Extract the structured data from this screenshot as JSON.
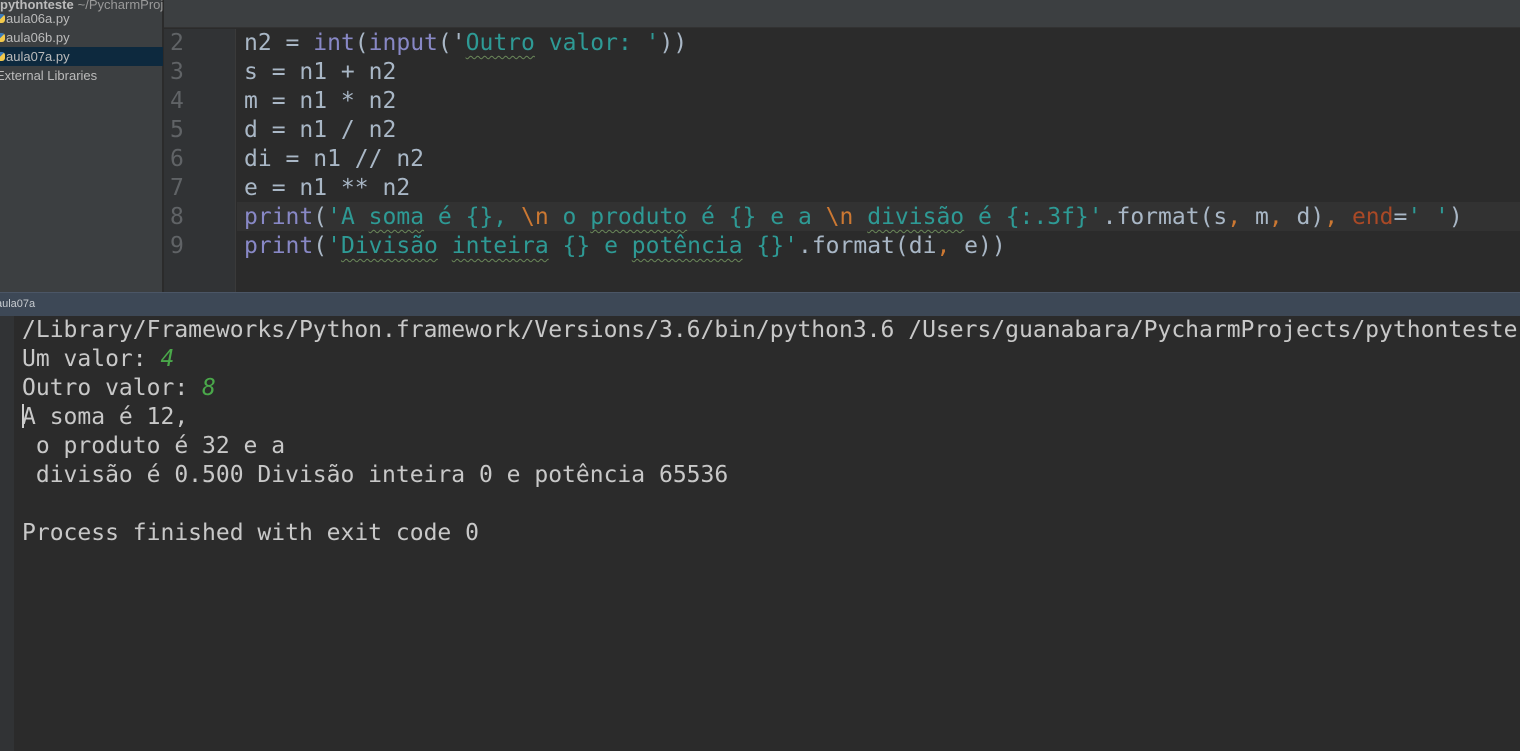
{
  "sidebar": {
    "project": "pythonteste",
    "project_path": "~/PycharmProj",
    "files": [
      "aula06a.py",
      "aula06b.py",
      "aula07a.py"
    ],
    "external": "External Libraries"
  },
  "editor": {
    "lines": [
      {
        "n": "2",
        "tokens": [
          [
            "n2 = ",
            ""
          ],
          [
            "int",
            "kw"
          ],
          [
            "(",
            ""
          ],
          [
            "input",
            "kw"
          ],
          [
            "(",
            ""
          ],
          [
            "'",
            ""
          ],
          [
            "Outro",
            "st wv"
          ],
          [
            " valor: '",
            "st"
          ],
          [
            "))",
            ""
          ]
        ]
      },
      {
        "n": "3",
        "tokens": [
          [
            "s = n1 + n2",
            ""
          ]
        ]
      },
      {
        "n": "4",
        "tokens": [
          [
            "m = n1 * n2",
            ""
          ]
        ]
      },
      {
        "n": "5",
        "tokens": [
          [
            "d = n1 / n2",
            ""
          ]
        ]
      },
      {
        "n": "6",
        "tokens": [
          [
            "di = n1 // n2",
            ""
          ]
        ]
      },
      {
        "n": "7",
        "tokens": [
          [
            "e = n1 ** n2",
            ""
          ]
        ]
      },
      {
        "n": "8",
        "tokens": [
          [
            "print",
            "kw"
          ],
          [
            "(",
            ""
          ],
          [
            "'A ",
            "st"
          ],
          [
            "soma",
            "st wv"
          ],
          [
            " é {}, ",
            "st"
          ],
          [
            "\\n",
            "es"
          ],
          [
            " o ",
            "st"
          ],
          [
            "produto",
            "st wv"
          ],
          [
            " é {} e a ",
            "st"
          ],
          [
            "\\n",
            "es"
          ],
          [
            " ",
            "st"
          ],
          [
            "divisão",
            "st wv"
          ],
          [
            " é {:.3f}'",
            "st"
          ],
          [
            ".format(s",
            ""
          ],
          [
            ", ",
            "cm"
          ],
          [
            "m",
            ""
          ],
          [
            ", ",
            "cm"
          ],
          [
            "d)",
            ""
          ],
          [
            ", ",
            "cm"
          ],
          [
            "end",
            "pa"
          ],
          [
            "=",
            ""
          ],
          [
            "' '",
            "st"
          ],
          [
            ")",
            ""
          ]
        ]
      },
      {
        "n": "9",
        "tokens": [
          [
            "print",
            "kw"
          ],
          [
            "(",
            ""
          ],
          [
            "'",
            "st"
          ],
          [
            "Divisão",
            "st wv"
          ],
          [
            " ",
            "st"
          ],
          [
            "inteira",
            "st wv"
          ],
          [
            " {} e ",
            "st"
          ],
          [
            "potência",
            "st wv"
          ],
          [
            " {}'",
            "st"
          ],
          [
            ".format(di",
            ""
          ],
          [
            ", ",
            "cm"
          ],
          [
            "e))",
            ""
          ]
        ]
      }
    ]
  },
  "console": {
    "tab": "aula07a",
    "lines": [
      [
        [
          "/Library/Frameworks/Python.framework/Versions/3.6/bin/python3.6 /Users/guanabara/PycharmProjects/pythonteste",
          ""
        ]
      ],
      [
        [
          "Um valor: ",
          ""
        ],
        [
          "4",
          "in"
        ]
      ],
      [
        [
          "Outro valor: ",
          ""
        ],
        [
          "8",
          "in"
        ]
      ],
      [
        [
          "A soma é 12,",
          ""
        ]
      ],
      [
        [
          " o produto é 32 e a",
          ""
        ]
      ],
      [
        [
          " divisão é 0.500 Divisão inteira 0 e potência 65536",
          ""
        ]
      ],
      [
        [
          "",
          ""
        ]
      ],
      [
        [
          "Process finished with exit code 0",
          ""
        ]
      ]
    ]
  }
}
